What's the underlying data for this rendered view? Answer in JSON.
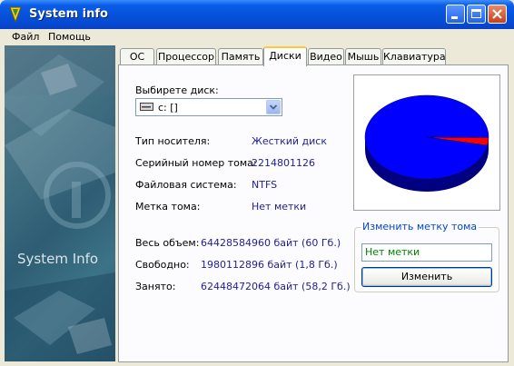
{
  "window": {
    "title": "System info",
    "colors": {
      "titlebar": "#0551d8",
      "face": "#ECE9D8",
      "value_text": "#1e1e96",
      "accent_tab": "#ffc83c"
    }
  },
  "icons": [
    "app-icon",
    "minimize-icon",
    "maximize-icon",
    "close-icon",
    "disk-drive-icon",
    "chevron-down-icon"
  ],
  "menu": {
    "items": [
      "Файл",
      "Помощь"
    ]
  },
  "sidebar": {
    "label": "System Info"
  },
  "tabs": [
    {
      "label": "ОС",
      "active": false
    },
    {
      "label": "Процессор",
      "active": false
    },
    {
      "label": "Память",
      "active": false
    },
    {
      "label": "Диски",
      "active": true
    },
    {
      "label": "Видео",
      "active": false
    },
    {
      "label": "Мышь",
      "active": false
    },
    {
      "label": "Клавиатура",
      "active": false
    }
  ],
  "disk": {
    "select_label": "Выбирете диск:",
    "selected_disk": "c: []",
    "props": [
      {
        "label": "Тип носителя:",
        "value": "Жесткий диск"
      },
      {
        "label": "Серийный номер тома:",
        "value": "2214801126"
      },
      {
        "label": "Файловая система:",
        "value": "NTFS"
      },
      {
        "label": "Метка тома:",
        "value": "Нет метки"
      }
    ],
    "space": [
      {
        "label": "Весь объем:",
        "value": "64428584960 байт  (60 Гб.)"
      },
      {
        "label": "Свободно:",
        "value": "1980112896 байт  (1,8 Гб.)"
      },
      {
        "label": "Занято:",
        "value": "62448472064 байт  (58,2 Гб.)"
      }
    ]
  },
  "rename": {
    "group_title": "Изменить метку тома",
    "input_value": "Нет метки",
    "button_label": "Изменить"
  },
  "chart_data": {
    "type": "pie",
    "slices": [
      {
        "label": "Занято",
        "value": 62448472064,
        "color": "#0000ff"
      },
      {
        "label": "Свободно",
        "value": 1980112896,
        "color": "#ff0000"
      }
    ]
  }
}
